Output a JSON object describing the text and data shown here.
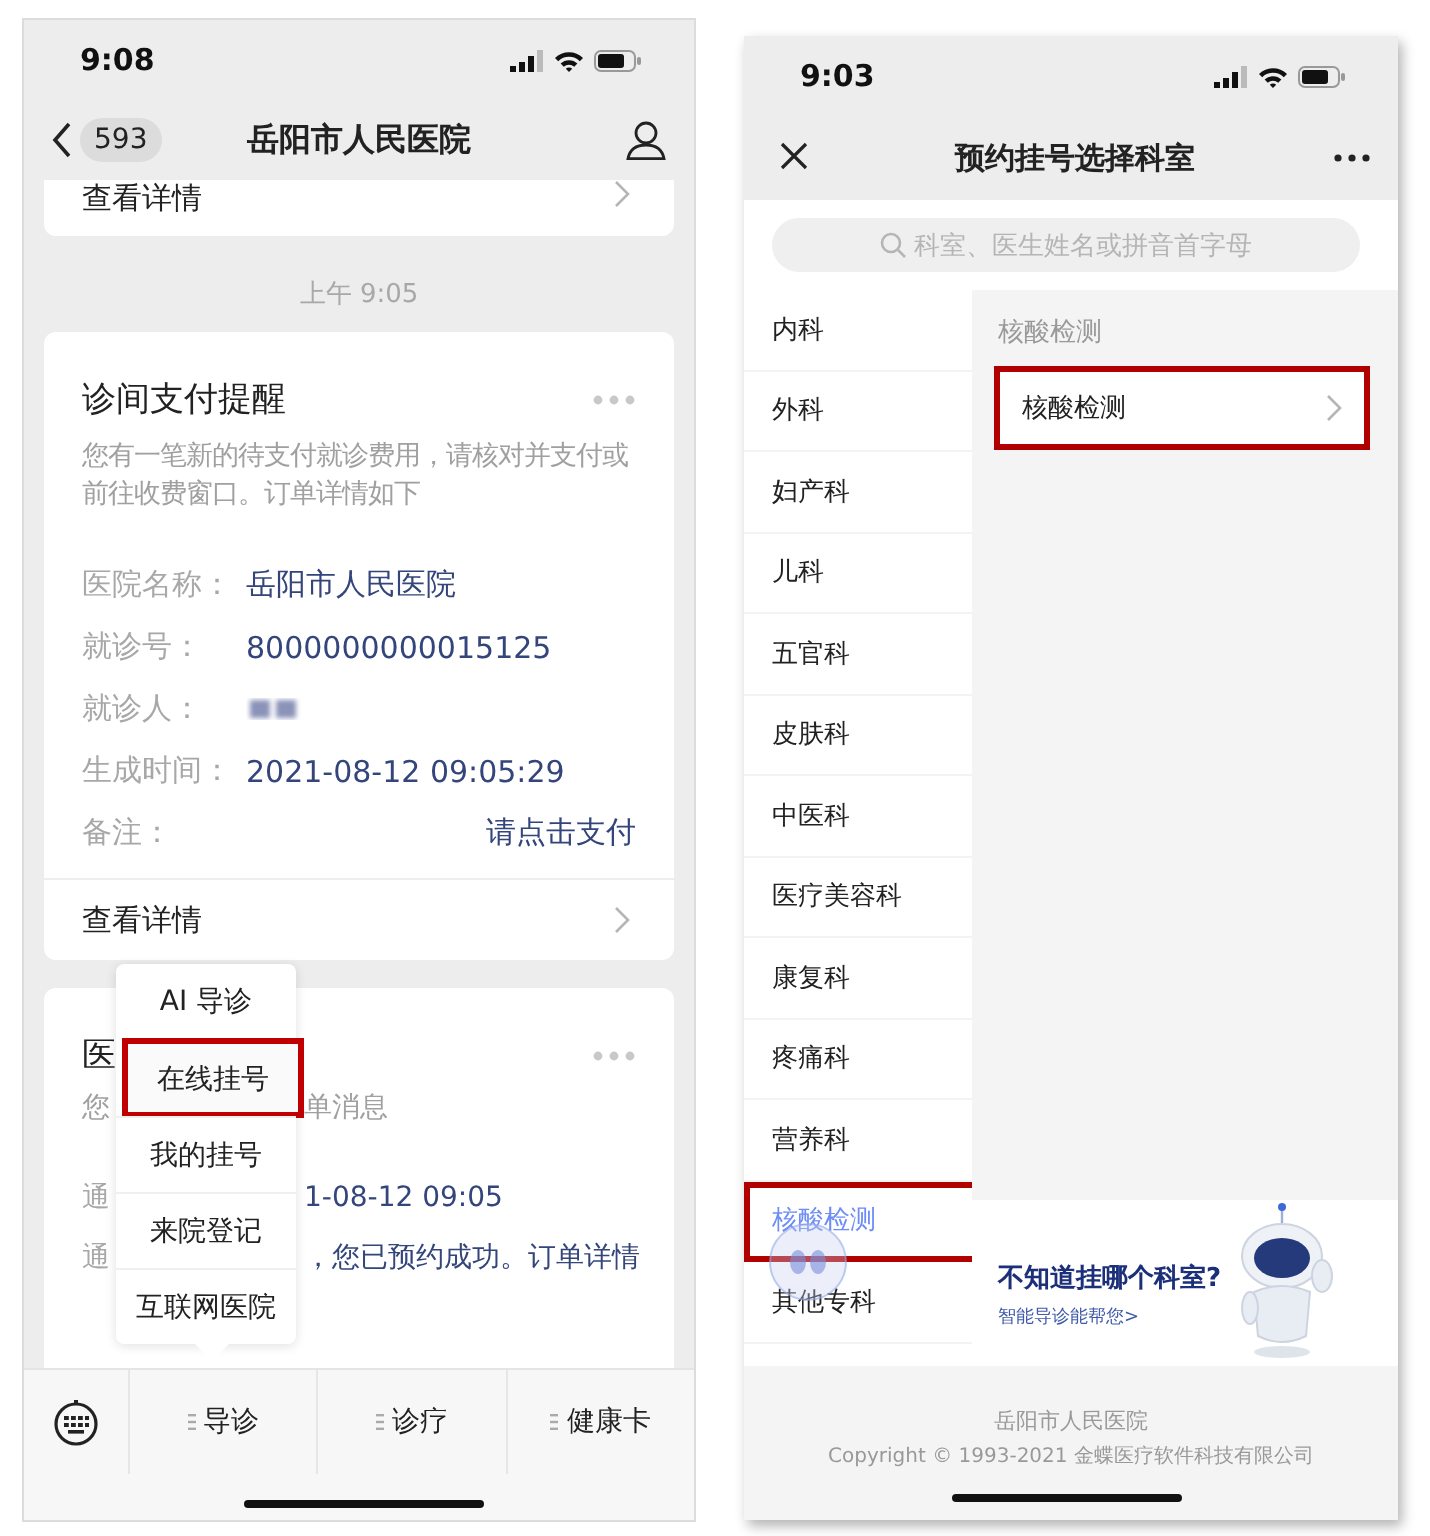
{
  "left_phone": {
    "status_bar": {
      "time": "9:08"
    },
    "nav": {
      "back_count": "593",
      "title": "岳阳市人民医院"
    },
    "top_card": {
      "link": "查看详情"
    },
    "timestamp": "上午 9:05",
    "payment_card": {
      "title": "诊间支付提醒",
      "description": "您有一笔新的待支付就诊费用，请核对并支付或前往收费窗口。订单详情如下",
      "fields": [
        {
          "kind": "text",
          "label": "医院名称：",
          "value": "岳阳市人民医院"
        },
        {
          "kind": "text",
          "label": "就诊号：",
          "value": "8000000000015125"
        },
        {
          "kind": "blurred",
          "label": "就诊人："
        },
        {
          "kind": "text",
          "label": "生成时间：",
          "value": "2021-08-12 09:05:29"
        },
        {
          "kind": "link",
          "label": "备注：",
          "value": "请点击支付"
        }
      ],
      "link": "查看详情"
    },
    "notice_card": {
      "title": "医",
      "description_parts": [
        "您",
        "单消息"
      ],
      "rows": [
        {
          "label": "通",
          "value": "1-08-12 09:05"
        },
        {
          "label": "通",
          "value": "，您已预约成功。订单详情"
        }
      ]
    },
    "popup_menu": [
      {
        "label": "AI 导诊",
        "highlighted": false
      },
      {
        "label": "在线挂号",
        "highlighted": true
      },
      {
        "label": "我的挂号",
        "highlighted": false
      },
      {
        "label": "来院登记",
        "highlighted": false
      },
      {
        "label": "互联网医院",
        "highlighted": false
      }
    ],
    "bottom_menu": [
      {
        "label": "导诊"
      },
      {
        "label": "诊疗"
      },
      {
        "label": "健康卡"
      }
    ]
  },
  "right_phone": {
    "status_bar": {
      "time": "9:03"
    },
    "nav": {
      "title": "预约挂号选择科室"
    },
    "search": {
      "placeholder": "科室、医生姓名或拼音首字母"
    },
    "departments": [
      {
        "label": "内科",
        "selected": false,
        "highlighted": false
      },
      {
        "label": "外科",
        "selected": false,
        "highlighted": false
      },
      {
        "label": "妇产科",
        "selected": false,
        "highlighted": false
      },
      {
        "label": "儿科",
        "selected": false,
        "highlighted": false
      },
      {
        "label": "五官科",
        "selected": false,
        "highlighted": false
      },
      {
        "label": "皮肤科",
        "selected": false,
        "highlighted": false
      },
      {
        "label": "中医科",
        "selected": false,
        "highlighted": false
      },
      {
        "label": "医疗美容科",
        "selected": false,
        "highlighted": false
      },
      {
        "label": "康复科",
        "selected": false,
        "highlighted": false
      },
      {
        "label": "疼痛科",
        "selected": false,
        "highlighted": false
      },
      {
        "label": "营养科",
        "selected": false,
        "highlighted": false
      },
      {
        "label": "核酸检测",
        "selected": true,
        "highlighted": true
      },
      {
        "label": "其他专科",
        "selected": false,
        "highlighted": false
      }
    ],
    "section_title": "核酸检测",
    "sub_departments": [
      {
        "label": "核酸检测",
        "highlighted": true
      }
    ],
    "banner": {
      "title": "不知道挂哪个科室?",
      "link": "智能导诊能帮您>"
    },
    "footer": {
      "hospital": "岳阳市人民医院",
      "copyright": "Copyright © 1993-2021 金蝶医疗软件科技有限公司"
    }
  }
}
